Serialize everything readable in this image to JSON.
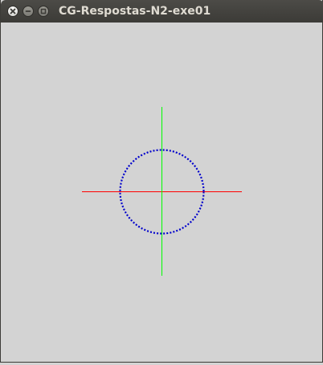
{
  "window": {
    "title": "CG-Respostas-N2-exe01",
    "controls": {
      "close_icon": "close-icon",
      "minimize_icon": "minimize-icon",
      "maximize_icon": "maximize-icon"
    }
  },
  "canvas": {
    "background_color": "#d3d3d3",
    "x_axis_color": "#ff0000",
    "y_axis_color": "#00ff00",
    "circle_color": "#0000cc",
    "circle_style": "dotted"
  }
}
